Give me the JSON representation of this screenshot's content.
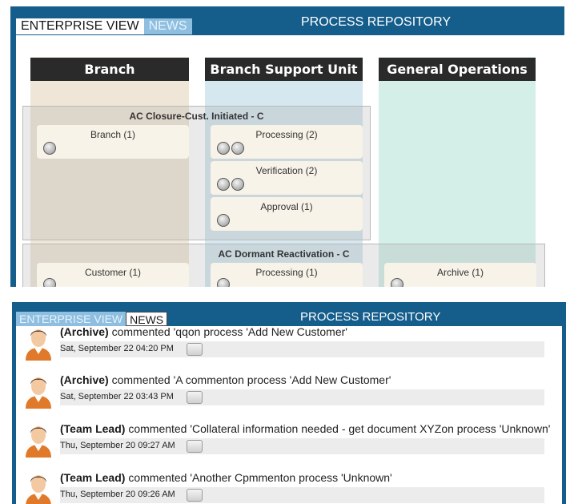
{
  "enterprise": {
    "tabs": {
      "enterprise": "ENTERPRISE VIEW",
      "news": "NEWS"
    },
    "title": "PROCESS REPOSITORY",
    "lanes": [
      "Branch",
      "Branch Support Unit",
      "General Operations"
    ],
    "groups": [
      {
        "title": "AC Closure-Cust. Initiated - C",
        "cards": [
          {
            "label": "Branch (1)",
            "count": 1
          },
          {
            "label": "Processing (2)",
            "count": 2
          },
          {
            "label": "Verification (2)",
            "count": 2
          },
          {
            "label": "Approval (1)",
            "count": 1
          }
        ]
      },
      {
        "title": "AC Dormant Reactivation - C",
        "cards": [
          {
            "label": "Customer (1)",
            "count": 1
          },
          {
            "label": "Processing (1)",
            "count": 1
          },
          {
            "label": "Archive (1)",
            "count": 1
          }
        ]
      }
    ]
  },
  "news": {
    "tabs": {
      "enterprise": "ENTERPRISE VIEW",
      "news": "NEWS"
    },
    "title": "PROCESS REPOSITORY",
    "entries": [
      {
        "author": "(Archive)",
        "text": " commented 'qqon process 'Add New Customer'",
        "date": "Sat, September 22 04:20 PM"
      },
      {
        "author": "(Archive)",
        "text": " commented 'A commenton process 'Add New Customer'",
        "date": "Sat, September 22 03:43 PM"
      },
      {
        "author": "(Team Lead)",
        "text": " commented 'Collateral information needed - get document XYZon process 'Unknown'",
        "date": "Thu, September 20 09:27 AM"
      },
      {
        "author": "(Team Lead)",
        "text": " commented 'Another Cpmmenton process 'Unknown'",
        "date": "Thu, September 20 09:26 AM"
      }
    ]
  },
  "colors": {
    "header_bg": "#155e8c",
    "lane_branch": "#efe6d7",
    "lane_bsu": "#d5e7ef",
    "lane_general": "#d4efe7",
    "lane_header": "#2a2a2a"
  }
}
